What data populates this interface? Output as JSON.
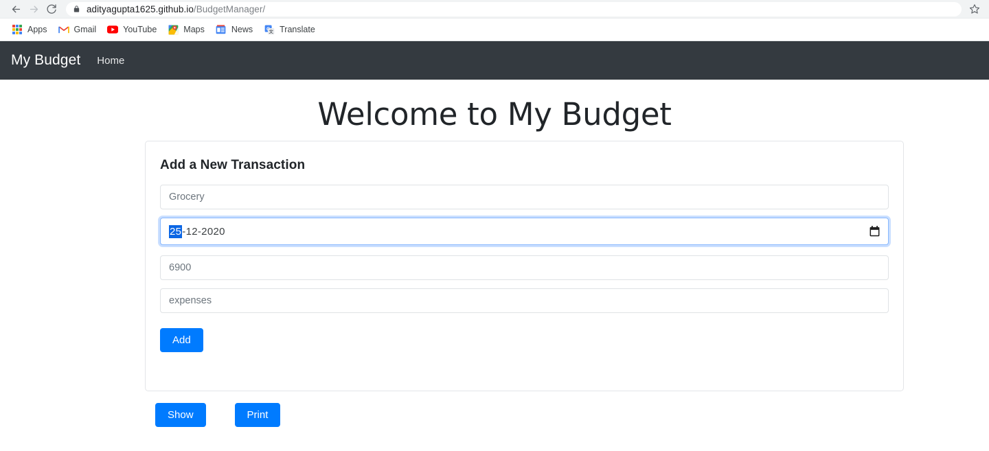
{
  "browser": {
    "back_icon": "back-arrow-icon",
    "forward_icon": "forward-arrow-icon",
    "reload_icon": "reload-icon",
    "lock_icon": "lock-icon",
    "url_domain": "adityagupta1625.github.io",
    "url_path": "/BudgetManager/",
    "star_icon": "bookmark-star-icon",
    "bookmarks": [
      {
        "label": "Apps",
        "icon": "apps-grid-icon"
      },
      {
        "label": "Gmail",
        "icon": "gmail-icon"
      },
      {
        "label": "YouTube",
        "icon": "youtube-icon"
      },
      {
        "label": "Maps",
        "icon": "maps-icon"
      },
      {
        "label": "News",
        "icon": "news-icon"
      },
      {
        "label": "Translate",
        "icon": "translate-icon"
      }
    ]
  },
  "navbar": {
    "brand": "My Budget",
    "links": [
      {
        "label": "Home"
      }
    ],
    "background_color": "#343a40"
  },
  "hero": {
    "title": "Welcome to My Budget"
  },
  "card": {
    "title": "Add a New Transaction",
    "fields": {
      "description": {
        "placeholder": "Grocery"
      },
      "date": {
        "selected_segment": "25",
        "rest": "-12-2020",
        "full_value": "25-12-2020",
        "focused": true,
        "calendar_icon": "calendar-icon"
      },
      "amount": {
        "placeholder": "6900"
      },
      "type": {
        "placeholder": "expenses"
      }
    },
    "add_button": "Add"
  },
  "actions": {
    "show_button": "Show",
    "print_button": "Print"
  },
  "colors": {
    "primary": "#007bff",
    "navbar_dark": "#343a40",
    "focus_ring": "#86b7fe",
    "selection_blue": "#0b66e4"
  }
}
